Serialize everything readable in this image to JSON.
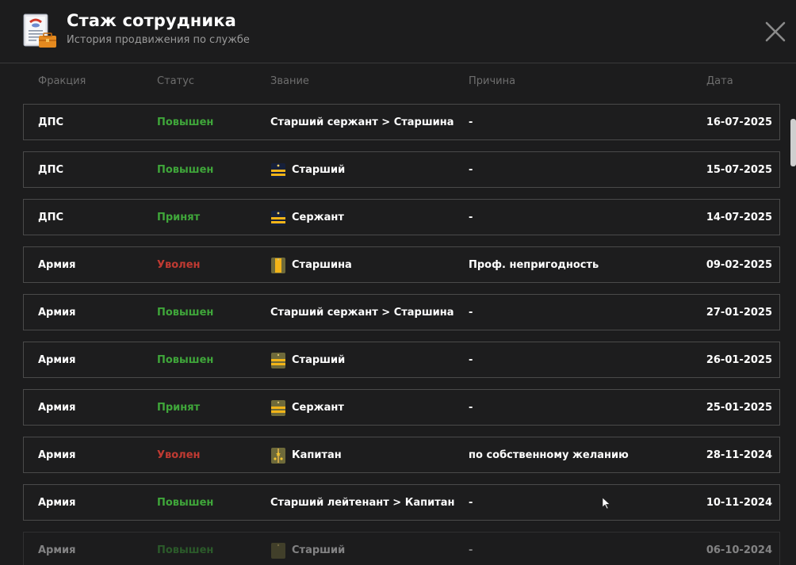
{
  "header": {
    "title": "Стаж сотрудника",
    "subtitle": "История продвижения по службе",
    "close_icon": "close-icon"
  },
  "columns": {
    "faction": "Фракция",
    "status": "Статус",
    "rank": "Звание",
    "reason": "Причина",
    "date": "Дата"
  },
  "colors": {
    "promoted": "#3fa63a",
    "hired": "#3fa63a",
    "fired": "#c03a32"
  },
  "rows": [
    {
      "faction": "ДПС",
      "status": "Повышен",
      "status_type": "up",
      "rank": "Старший сержант > Старшина",
      "badge": "",
      "reason": "-",
      "date": "16-07-2025"
    },
    {
      "faction": "ДПС",
      "status": "Повышен",
      "status_type": "up",
      "rank": "Старший",
      "badge": "police-sergeant-badge",
      "reason": "-",
      "date": "15-07-2025"
    },
    {
      "faction": "ДПС",
      "status": "Принят",
      "status_type": "hired",
      "rank": "Сержант",
      "badge": "police-sergeant-badge",
      "reason": "-",
      "date": "14-07-2025"
    },
    {
      "faction": "Армия",
      "status": "Уволен",
      "status_type": "fired",
      "rank": "Старшина",
      "badge": "army-starshina-badge",
      "reason": "Проф. непригодность",
      "date": "09-02-2025"
    },
    {
      "faction": "Армия",
      "status": "Повышен",
      "status_type": "up",
      "rank": "Старший сержант > Старшина",
      "badge": "",
      "reason": "-",
      "date": "27-01-2025"
    },
    {
      "faction": "Армия",
      "status": "Повышен",
      "status_type": "up",
      "rank": "Старший",
      "badge": "army-sergeant-badge",
      "reason": "-",
      "date": "26-01-2025"
    },
    {
      "faction": "Армия",
      "status": "Принят",
      "status_type": "hired",
      "rank": "Сержант",
      "badge": "army-sergeant-badge",
      "reason": "-",
      "date": "25-01-2025"
    },
    {
      "faction": "Армия",
      "status": "Уволен",
      "status_type": "fired",
      "rank": "Капитан",
      "badge": "army-captain-badge",
      "reason": "по собственному желанию",
      "date": "28-11-2024"
    },
    {
      "faction": "Армия",
      "status": "Повышен",
      "status_type": "up",
      "rank": "Старший лейтенант > Капитан",
      "badge": "",
      "reason": "-",
      "date": "10-11-2024"
    },
    {
      "faction": "Армия",
      "status": "Повышен",
      "status_type": "up",
      "rank": "Старший",
      "badge": "army-plain-badge",
      "reason": "-",
      "date": "06-10-2024"
    }
  ]
}
